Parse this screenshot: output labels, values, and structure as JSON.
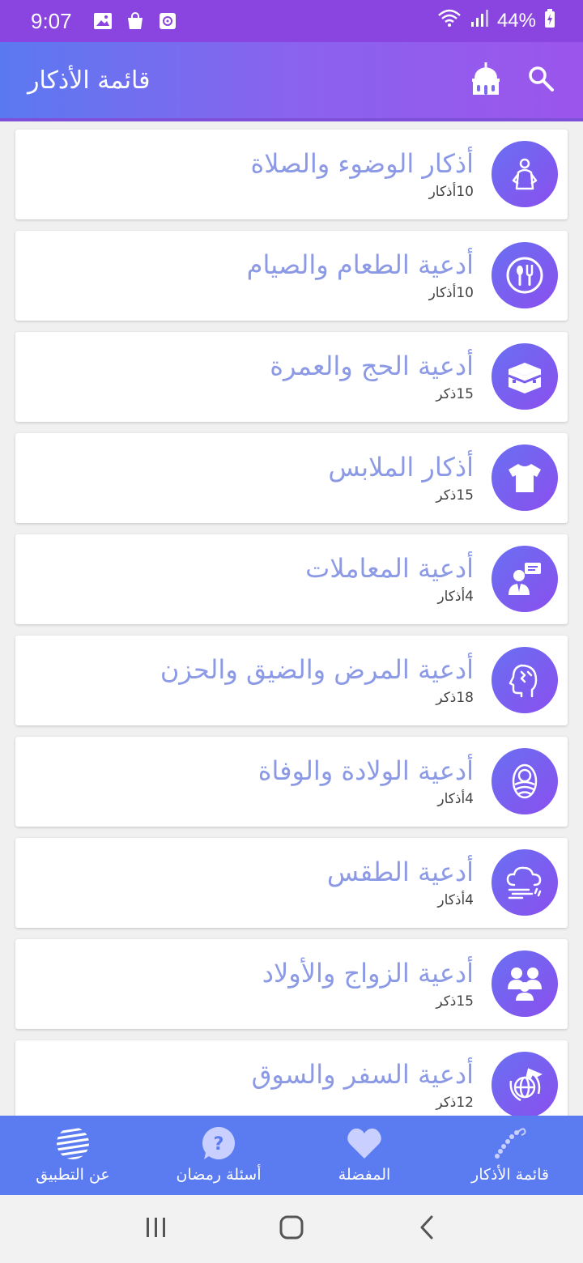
{
  "status": {
    "time": "9:07",
    "battery": "44%",
    "left_icons": [
      "image-icon",
      "shopping-bag-icon",
      "clock-app-icon"
    ],
    "right_icons": [
      "wifi-icon",
      "signal-icon",
      "battery-charging-icon"
    ]
  },
  "header": {
    "title": "قائمة الأذكار",
    "actions": [
      "search-icon",
      "mosque-icon"
    ]
  },
  "categories": [
    {
      "title": "أذكار الوضوء والصلاة",
      "count": "10أذكار",
      "icon": "prayer-icon"
    },
    {
      "title": "أدعية الطعام والصيام",
      "count": "10أذكار",
      "icon": "food-icon"
    },
    {
      "title": "أدعية الحج والعمرة",
      "count": "15ذكر",
      "icon": "kaaba-icon"
    },
    {
      "title": "أذكار الملابس",
      "count": "15ذكر",
      "icon": "tshirt-icon"
    },
    {
      "title": "أدعية المعاملات",
      "count": "4أذكار",
      "icon": "business-person-icon"
    },
    {
      "title": "أدعية المرض والضيق والحزن",
      "count": "18ذكر",
      "icon": "head-pain-icon"
    },
    {
      "title": "أدعية الولادة والوفاة",
      "count": "4أذكار",
      "icon": "baby-icon"
    },
    {
      "title": "أدعية الطقس",
      "count": "4أذكار",
      "icon": "weather-icon"
    },
    {
      "title": "أدعية الزواج والأولاد",
      "count": "15ذكر",
      "icon": "family-icon"
    },
    {
      "title": "أدعية السفر والسوق",
      "count": "12ذكر",
      "icon": "travel-icon"
    }
  ],
  "bottom_nav": [
    {
      "label": "عن التطبيق",
      "icon": "about-icon"
    },
    {
      "label": "أسئلة رمضان",
      "icon": "question-icon"
    },
    {
      "label": "المفضلة",
      "icon": "heart-icon"
    },
    {
      "label": "قائمة الأذكار",
      "icon": "prayer-beads-icon"
    }
  ],
  "colors": {
    "status_bar": "#8a44e0",
    "header_start": "#5b79f0",
    "header_end": "#9b55ec",
    "card_title": "#8c9ae6",
    "icon_circle": "#7a5cf0",
    "bottom_nav": "#5b7cf0"
  }
}
